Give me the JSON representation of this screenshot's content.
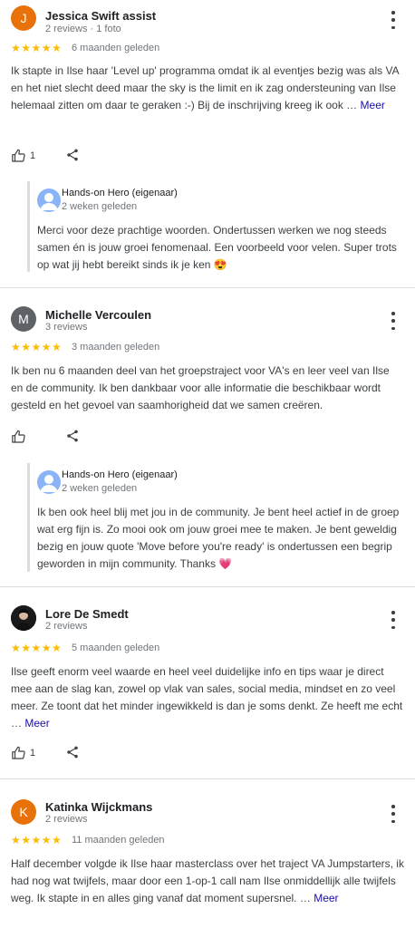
{
  "reviews": [
    {
      "initial": "J",
      "avatar_color": "#e8710a",
      "name": "Jessica Swift assist",
      "meta": "2 reviews · 1 foto",
      "stars": "★★★★★",
      "when": "6 maanden geleden",
      "text": "Ik stapte in Ilse haar 'Level up' programma omdat ik al eventjes bezig was als VA en het niet slecht deed maar the sky is the limit en ik zag ondersteuning van Ilse helemaal zitten om daar te geraken :-) Bij de inschrijving kreeg ik ook …",
      "more_link": "Meer",
      "like_count": "1",
      "owner_name": "Hands-on Hero (eigenaar)",
      "owner_when": "2 weken geleden",
      "owner_text": "Merci voor deze prachtige woorden. Ondertussen werken we nog steeds samen én is jouw groei fenomenaal. Een voorbeeld voor velen. Super trots op wat jij hebt bereikt sinds ik je ken 😍"
    },
    {
      "initial": "M",
      "avatar_color": "#5f6368",
      "name": "Michelle Vercoulen",
      "meta": "3 reviews",
      "stars": "★★★★★",
      "when": "3 maanden geleden",
      "text": "Ik ben nu 6 maanden deel van het groepstraject voor VA's en leer veel van Ilse en de community. Ik ben dankbaar voor alle informatie die beschikbaar wordt gesteld en het gevoel van saamhorigheid dat we samen creëren.",
      "like_count": "",
      "owner_name": "Hands-on Hero (eigenaar)",
      "owner_when": "2 weken geleden",
      "owner_text": "Ik ben ook heel blij met jou in de community. Je bent heel actief in de groep wat erg fijn is. Zo mooi ook om jouw groei mee te maken. Je bent geweldig bezig en jouw quote 'Move before you're ready' is ondertussen een begrip geworden in mijn community. Thanks 💗"
    },
    {
      "initial": "",
      "avatar_color": "#222222",
      "name": "Lore De Smedt",
      "meta": "2 reviews",
      "stars": "★★★★★",
      "when": "5 maanden geleden",
      "text": "Ilse geeft enorm veel waarde en heel veel duidelijke info en tips waar je direct mee aan de slag kan, zowel op vlak van sales, social media, mindset en zo veel meer. Ze toont dat het minder ingewikkeld is dan je soms denkt. Ze heeft me echt …",
      "more_link": "Meer",
      "like_count": "1"
    },
    {
      "initial": "K",
      "avatar_color": "#e8710a",
      "name": "Katinka Wijckmans",
      "meta": "2 reviews",
      "stars": "★★★★★",
      "when": "11 maanden geleden",
      "text": "Half december volgde ik Ilse haar masterclass over het traject VA Jumpstarters, ik had nog wat twijfels, maar door een 1-op-1 call nam Ilse onmiddellijk alle twijfels weg. Ik stapte in en alles ging vanaf dat moment supersnel. …",
      "more_link": "Meer"
    }
  ]
}
